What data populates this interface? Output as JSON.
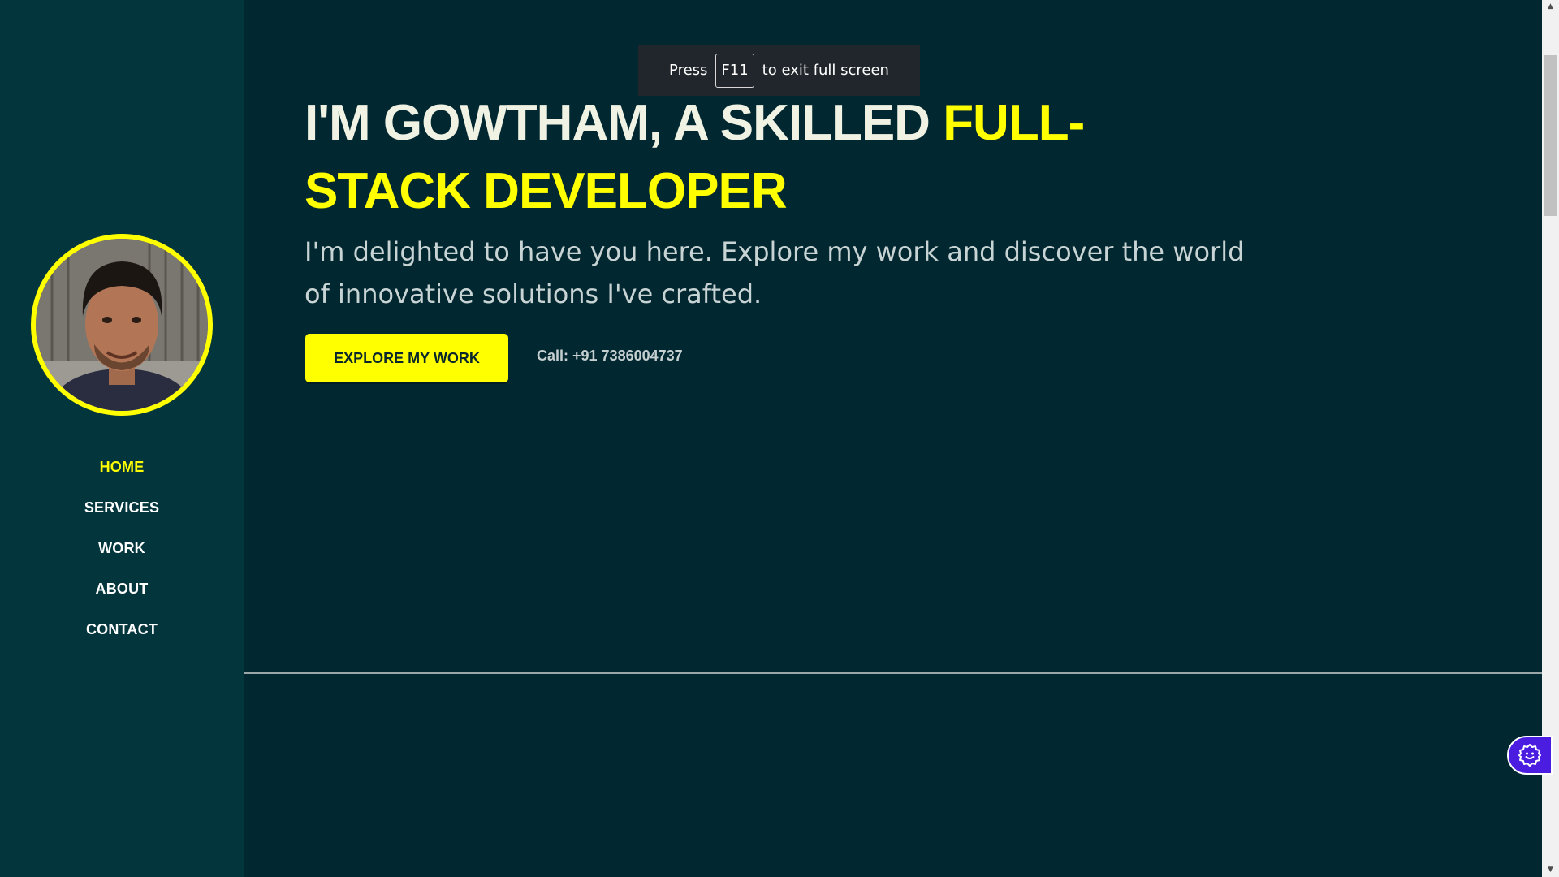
{
  "colors": {
    "background": "#012730",
    "sidebar": "#03353d",
    "accent": "#ffff00",
    "widget": "#4a1de0"
  },
  "sidebar": {
    "avatar_alt": "profile photo",
    "nav": [
      {
        "label": "HOME",
        "active": true
      },
      {
        "label": "SERVICES",
        "active": false
      },
      {
        "label": "WORK",
        "active": false
      },
      {
        "label": "ABOUT",
        "active": false
      },
      {
        "label": "CONTACT",
        "active": false
      }
    ]
  },
  "hero": {
    "headline_plain": "I'M GOWTHAM, A SKILLED ",
    "headline_highlight": "FULL-STACK DEVELOPER",
    "subtext": "I'm delighted to have you here. Explore my work and discover the world of innovative solutions I've crafted.",
    "cta_label": "EXPLORE MY WORK",
    "phone": "Call: +91 7386004737"
  },
  "fullscreen_notice": {
    "before": "Press",
    "key": "F11",
    "after": "to exit full screen"
  },
  "widget": {
    "icon": "gear-smile-icon"
  }
}
